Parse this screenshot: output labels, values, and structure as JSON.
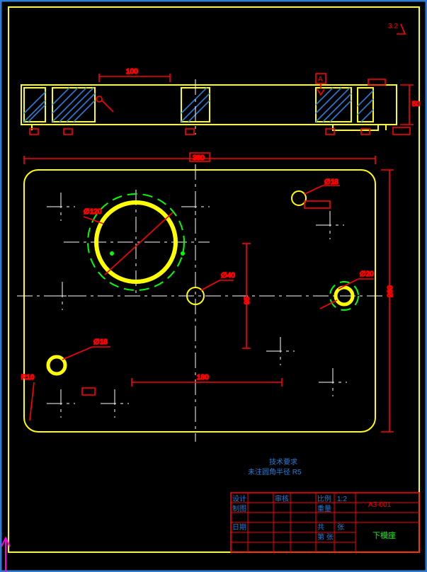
{
  "title_block": {
    "drawing_no": "A3-001",
    "drawing_name": "下模座",
    "note1_1": "技术要求",
    "note1_2": "未注圆角半径 R5",
    "rows": [
      [
        "设计",
        "",
        "审核",
        "",
        "比例",
        "1:2",
        ""
      ],
      [
        "制图",
        "",
        "",
        "",
        "重量",
        "",
        ""
      ],
      [
        "日期",
        "",
        "",
        "",
        "共",
        "张",
        "第  张"
      ]
    ]
  },
  "top_view": {
    "thickness_dim": "50",
    "datum_label": "A",
    "symbol_right": "3.2"
  },
  "plan_view": {
    "outer_width_dim": "360",
    "outer_height_dim": "260",
    "center_hole_callout": "∅40",
    "big_hole_callout": "∅120",
    "small_hole_callout_1": "∅18",
    "small_hole_callout_2": "∅20",
    "corner_callout": "R10",
    "vert_dim": "95",
    "horiz_dim": "180"
  }
}
